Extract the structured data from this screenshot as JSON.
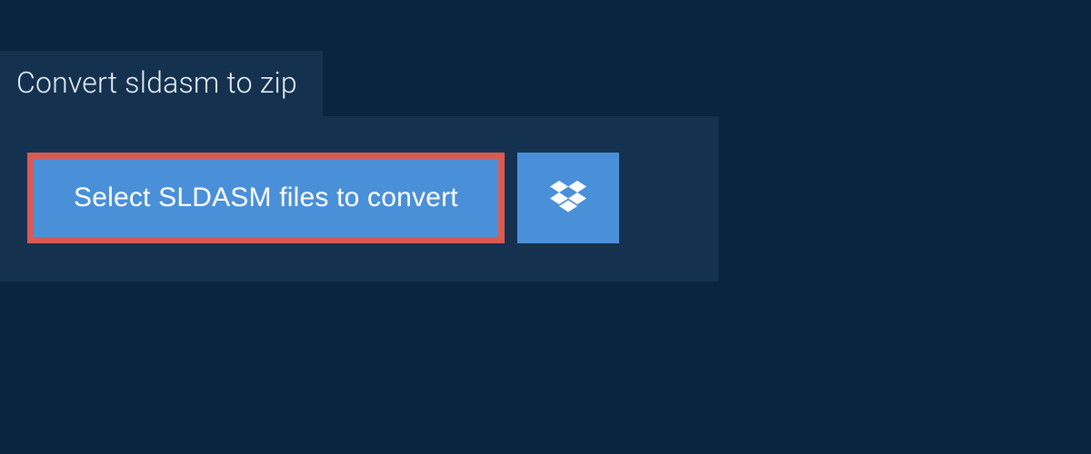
{
  "header": {
    "tab_label": "Convert sldasm to zip"
  },
  "actions": {
    "select_label": "Select SLDASM files to convert",
    "dropbox_icon": "dropbox-icon"
  },
  "colors": {
    "page_bg": "#0a2540",
    "panel_bg": "#14314f",
    "button_bg": "#4a90d9",
    "highlight_border": "#d85a52",
    "text_light": "#e8eef5"
  }
}
